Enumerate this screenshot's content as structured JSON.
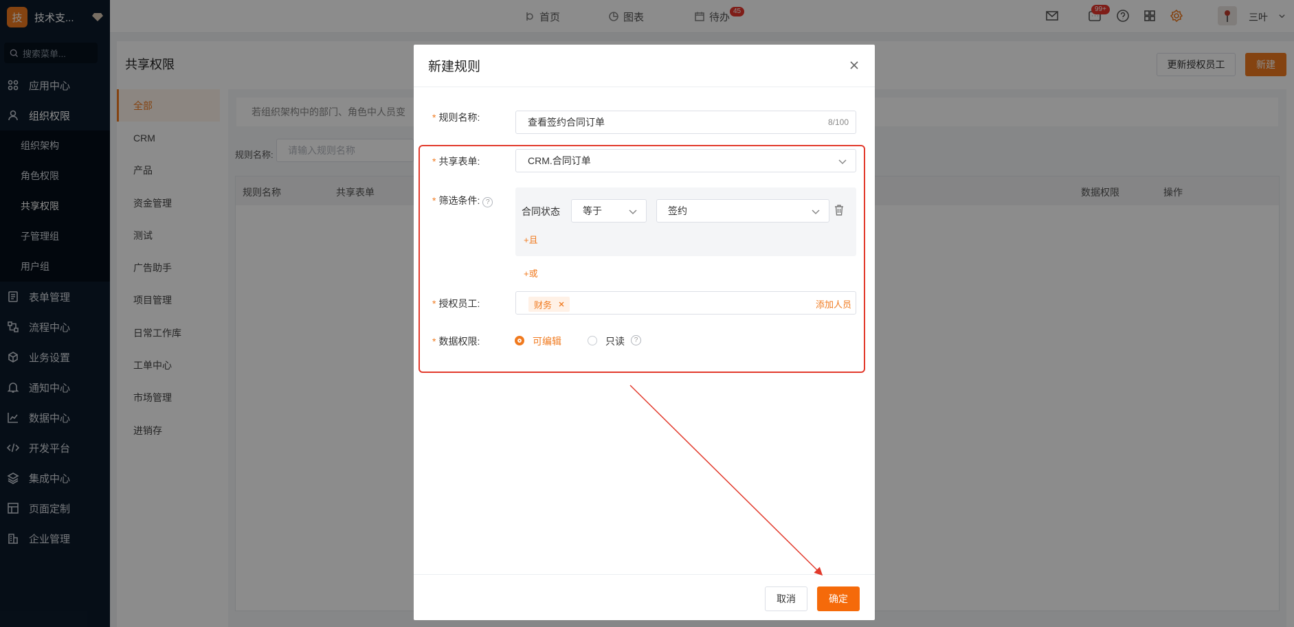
{
  "sidebar": {
    "logo_char": "技",
    "title": "技术支...",
    "search_placeholder": "搜索菜单...",
    "items": [
      {
        "label": "应用中心",
        "icon": "grid-command-icon"
      },
      {
        "label": "组织权限",
        "icon": "user-icon"
      },
      {
        "label": "表单管理",
        "icon": "form-icon"
      },
      {
        "label": "流程中心",
        "icon": "flow-icon"
      },
      {
        "label": "业务设置",
        "icon": "cube-icon"
      },
      {
        "label": "通知中心",
        "icon": "bell-icon"
      },
      {
        "label": "数据中心",
        "icon": "chart-line-icon"
      },
      {
        "label": "开发平台",
        "icon": "code-icon"
      },
      {
        "label": "集成中心",
        "icon": "layers-icon"
      },
      {
        "label": "页面定制",
        "icon": "layout-icon"
      },
      {
        "label": "企业管理",
        "icon": "building-icon"
      }
    ],
    "sub_items": [
      "组织架构",
      "角色权限",
      "共享权限",
      "子管理组",
      "用户组"
    ]
  },
  "topbar": {
    "home": "首页",
    "chart": "图表",
    "todo": "待办",
    "todo_badge": "45",
    "msg_badge": "99+",
    "user": "三叶"
  },
  "page": {
    "title": "共享权限",
    "update_btn": "更新授权员工",
    "new_btn": "新建",
    "tabs": [
      "全部",
      "CRM",
      "产品",
      "资金管理",
      "测试",
      "广告助手",
      "项目管理",
      "日常工作库",
      "工单中心",
      "市场管理",
      "进销存"
    ],
    "notice": "若组织架构中的部门、角色中人员变",
    "filter_label": "规则名称:",
    "filter_placeholder": "请输入规则名称",
    "columns": [
      "规则名称",
      "共享表单",
      "数据权限",
      "操作"
    ]
  },
  "modal": {
    "title": "新建规则",
    "name_label": "规则名称:",
    "name_value": "查看签约合同订单",
    "name_counter": "8/100",
    "form_label": "共享表单:",
    "form_value": "CRM.合同订单",
    "filter_label": "筛选条件:",
    "cond_field": "合同状态",
    "cond_op": "等于",
    "cond_value": "签约",
    "and_btn": "+且",
    "or_btn": "+或",
    "staff_label": "授权员工:",
    "staff_tag": "财务",
    "add_staff": "添加人员",
    "perm_label": "数据权限:",
    "perm_edit": "可编辑",
    "perm_read": "只读",
    "cancel": "取消",
    "ok": "确定"
  },
  "colors": {
    "accent": "#f07a1f",
    "annotation": "#e23a2c"
  }
}
